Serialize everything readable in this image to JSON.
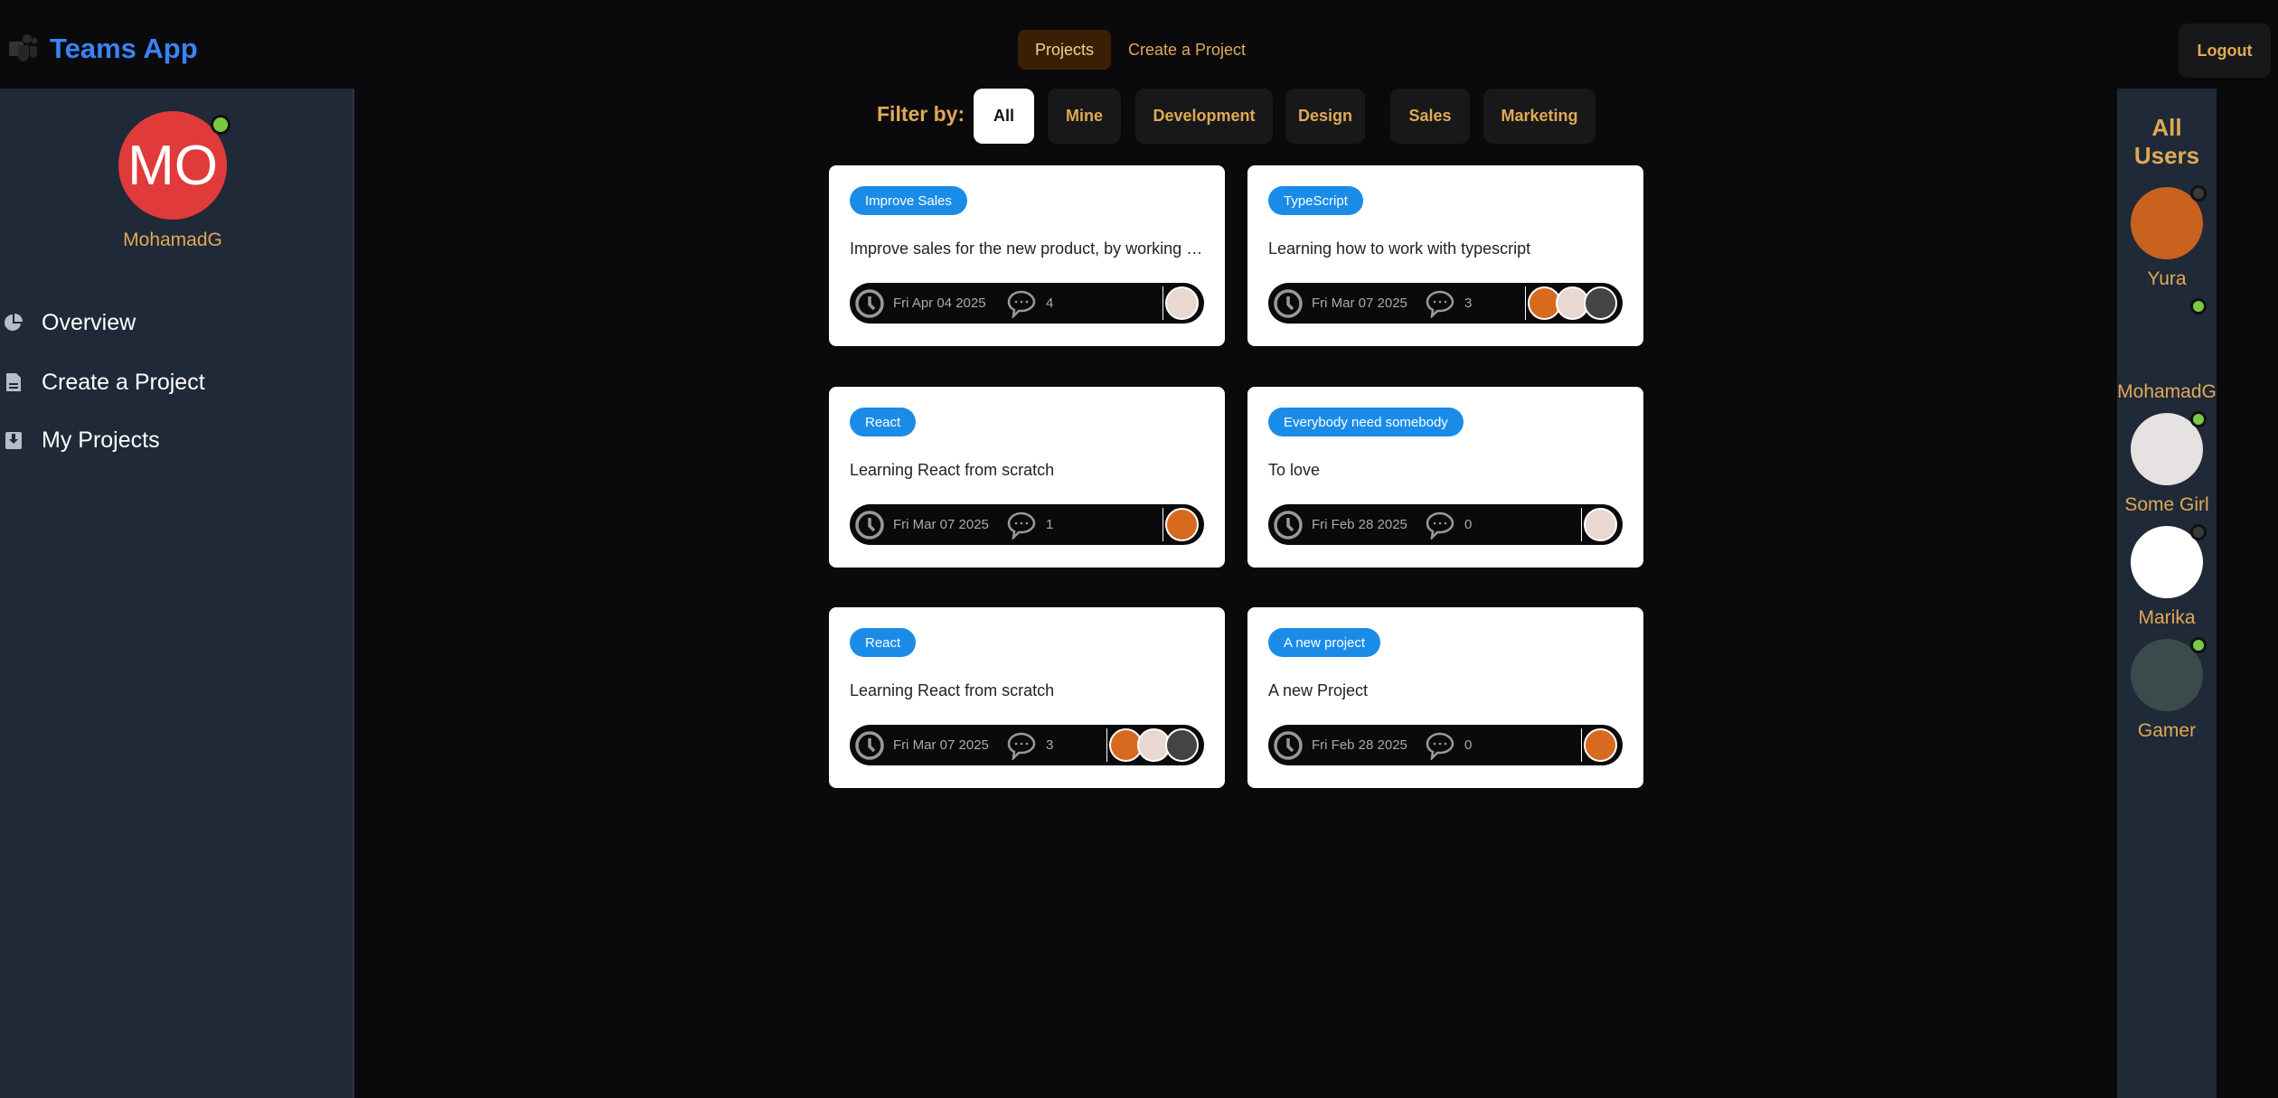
{
  "header": {
    "title": "Teams App",
    "nav": [
      {
        "label": "Projects",
        "active": true
      },
      {
        "label": "Create a Project"
      }
    ],
    "logout": "Logout"
  },
  "sidebar": {
    "initials": "MO",
    "username": "MohamadG",
    "online": true,
    "items": [
      {
        "label": "Overview",
        "icon": "pie-chart-icon"
      },
      {
        "label": "Create a Project",
        "icon": "document-icon"
      },
      {
        "label": "My Projects",
        "icon": "download-box-icon"
      }
    ]
  },
  "filter": {
    "label": "Filter by:",
    "options": [
      "All",
      "Mine",
      "Development",
      "Design",
      "Sales",
      "Marketing"
    ],
    "selected": "All"
  },
  "projects": [
    {
      "tag": "Improve Sales",
      "description": "Improve sales for the new product, by working on it",
      "date": "Fri Apr 04 2025",
      "comments": "4",
      "members": [
        "#e8d8d0"
      ]
    },
    {
      "tag": "TypeScript",
      "description": "Learning how to work with typescript",
      "date": "Fri Mar 07 2025",
      "comments": "3",
      "members": [
        "#d86a20",
        "#e8d8d0",
        "#444"
      ]
    },
    {
      "tag": "React",
      "description": "Learning React from scratch",
      "date": "Fri Mar 07 2025",
      "comments": "1",
      "members": [
        "#d86a20"
      ]
    },
    {
      "tag": "Everybody need somebody",
      "description": "To love",
      "date": "Fri Feb 28 2025",
      "comments": "0",
      "members": [
        "#e8d8d0"
      ]
    },
    {
      "tag": "React",
      "description": "Learning React from scratch",
      "date": "Fri Mar 07 2025",
      "comments": "3",
      "members": [
        "#d86a20",
        "#e8d8d0",
        "#444"
      ]
    },
    {
      "tag": "A new project",
      "description": "A new Project",
      "date": "Fri Feb 28 2025",
      "comments": "0",
      "members": [
        "#d86a20"
      ]
    }
  ],
  "users": {
    "title": "All Users",
    "list": [
      {
        "name": "Yura",
        "online": false,
        "color": "#c8621e"
      },
      {
        "name": "MohamadG",
        "online": true,
        "color": "#1f2937"
      },
      {
        "name": "Some Girl",
        "online": true,
        "color": "#e6e2e2"
      },
      {
        "name": "Marika",
        "online": false,
        "color": "#ffffff"
      },
      {
        "name": "Gamer",
        "online": true,
        "color": "#3b4a4a"
      }
    ]
  },
  "colors": {
    "accent": "#e0a955",
    "brand": "#3b82f6",
    "tag": "#1a8ce8",
    "panel": "#1f2937"
  }
}
